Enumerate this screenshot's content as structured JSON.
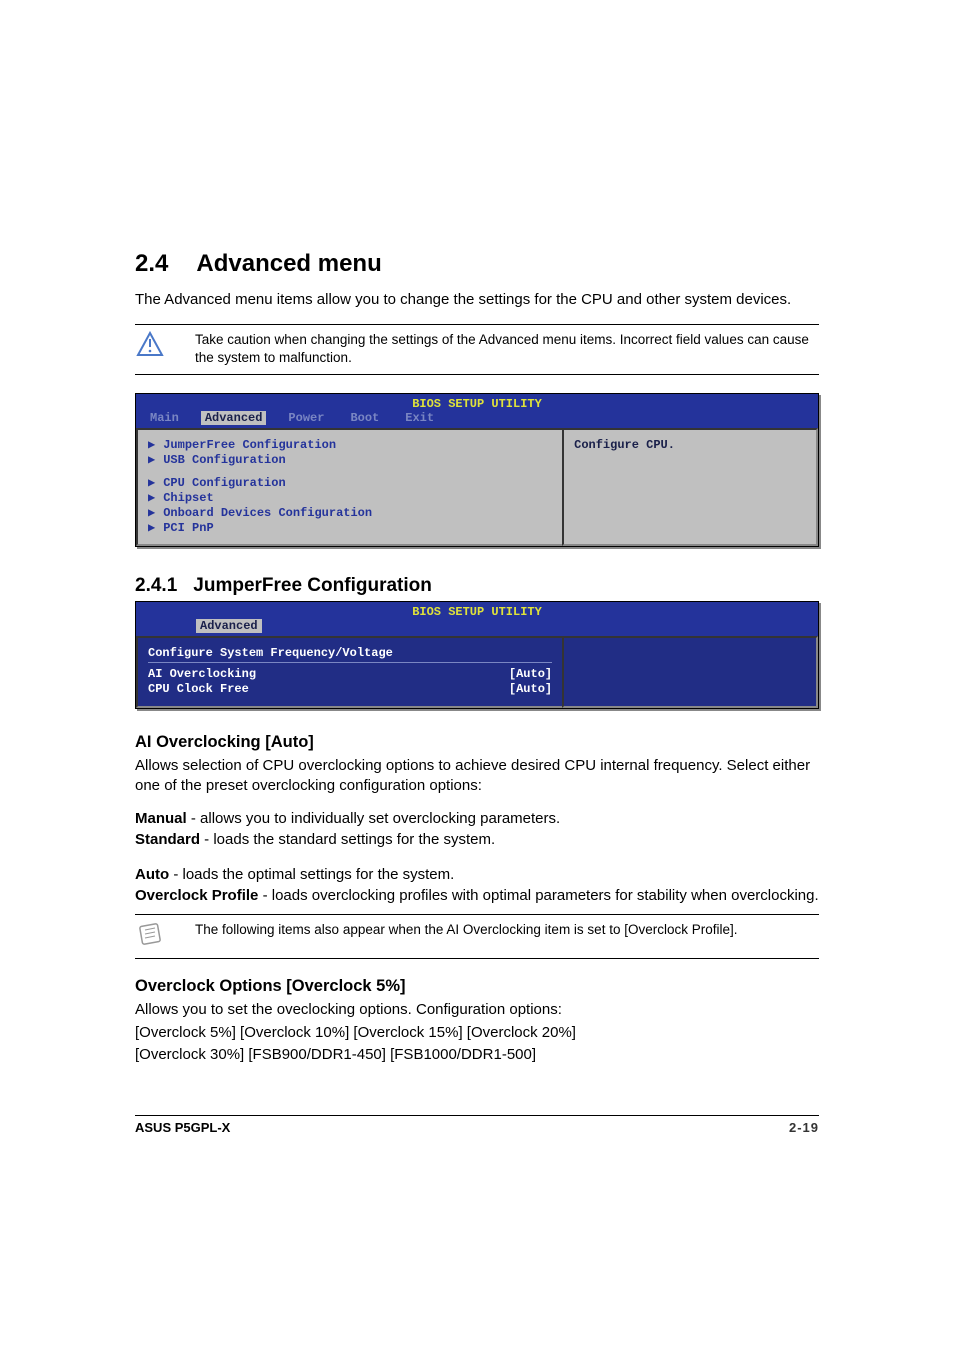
{
  "section": {
    "number": "2.4",
    "title": "Advanced menu",
    "intro": "The Advanced menu items allow you to change the settings for the CPU and other system devices.",
    "caution": "Take caution when changing the settings of the Advanced menu items. Incorrect field values can cause the system to malfunction."
  },
  "bios1": {
    "title": "BIOS SETUP UTILITY",
    "tabs": [
      "Main",
      "Advanced",
      "Power",
      "Boot",
      "Exit"
    ],
    "items_group1": [
      "JumperFree Configuration",
      "USB Configuration"
    ],
    "items_group2": [
      "CPU Configuration",
      "Chipset",
      "Onboard Devices Configuration",
      "PCI PnP"
    ],
    "help": "Configure CPU."
  },
  "sub": {
    "number": "2.4.1",
    "title": "JumperFree Configuration"
  },
  "bios2": {
    "title": "BIOS SETUP UTILITY",
    "tab": "Advanced",
    "section_title": "Configure System Frequency/Voltage",
    "rows": [
      {
        "label": "AI Overclocking",
        "value": "[Auto]"
      },
      {
        "label": "CPU Clock Free",
        "value": "[Auto]"
      }
    ]
  },
  "ai": {
    "heading": "AI Overclocking [Auto]",
    "desc": "Allows selection of CPU overclocking options to achieve desired CPU internal frequency. Select either one of the preset overclocking configuration options:",
    "options": [
      {
        "name": "Manual",
        "desc": " - allows you to individually set overclocking parameters."
      },
      {
        "name": "Standard",
        "desc": " - loads the standard settings for the system."
      },
      {
        "name": "Auto",
        "desc": " - loads the optimal settings for the system."
      },
      {
        "name": "Overclock Profile",
        "desc": " - loads overclocking profiles with optimal parameters for stability when overclocking."
      }
    ],
    "note": "The following items also appear when the AI Overclocking item is set to [Overclock Profile]."
  },
  "ocopt": {
    "heading": "Overclock Options [Overclock 5%]",
    "line1": "Allows you to set the oveclocking options.    Configuration options:",
    "line2": "[Overclock 5%] [Overclock 10%] [Overclock 15%] [Overclock 20%]",
    "line3": "[Overclock 30%] [FSB900/DDR1-450] [FSB1000/DDR1-500]"
  },
  "footer": {
    "product": "ASUS P5GPL-X",
    "page": "2-19"
  }
}
